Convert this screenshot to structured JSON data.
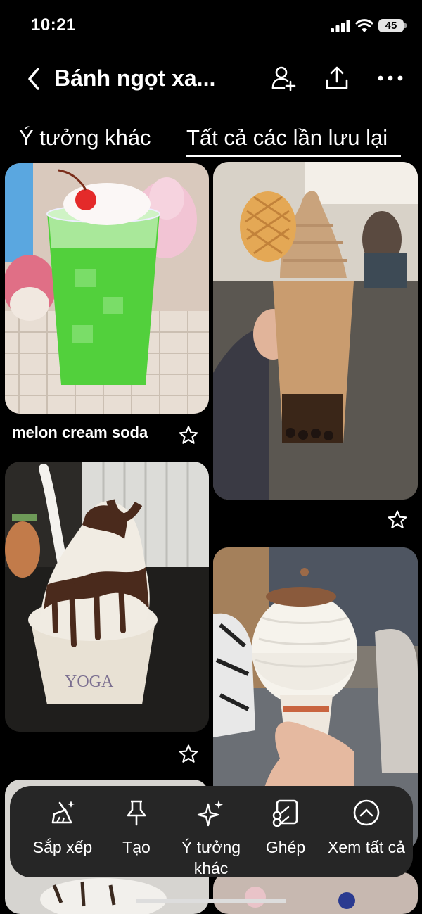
{
  "status_bar": {
    "time": "10:21",
    "battery": "45"
  },
  "header": {
    "title": "Bánh ngọt xa..."
  },
  "tabs": [
    {
      "label": "Ý tưởng khác",
      "selected": false
    },
    {
      "label": "Tất cả các lần lưu lại",
      "selected": true
    }
  ],
  "pins": [
    {
      "caption": "melon cream soda",
      "image": "melon cream soda with cherry and whipped cream"
    },
    {
      "caption": "",
      "image": "Surreal Creamery soft serve with waffle cone"
    },
    {
      "caption": "",
      "image": "chocolate-dipped soft serve in Yogurtland cup"
    },
    {
      "caption": "",
      "image": "soft serve cone topped with crumbs"
    }
  ],
  "action_bar": {
    "items": [
      {
        "label": "Sắp xếp",
        "icon": "broom-sparkle-icon"
      },
      {
        "label": "Tạo",
        "icon": "pin-icon"
      },
      {
        "label": "Ý tưởng khác",
        "icon": "sparkle-icon"
      },
      {
        "label": "Ghép",
        "icon": "collage-cut-icon"
      },
      {
        "label": "Xem tất cả",
        "icon": "chevron-up-circle-icon"
      }
    ]
  },
  "colors": {
    "background": "#000000",
    "action_bar": "#262626",
    "text": "#ffffff"
  }
}
